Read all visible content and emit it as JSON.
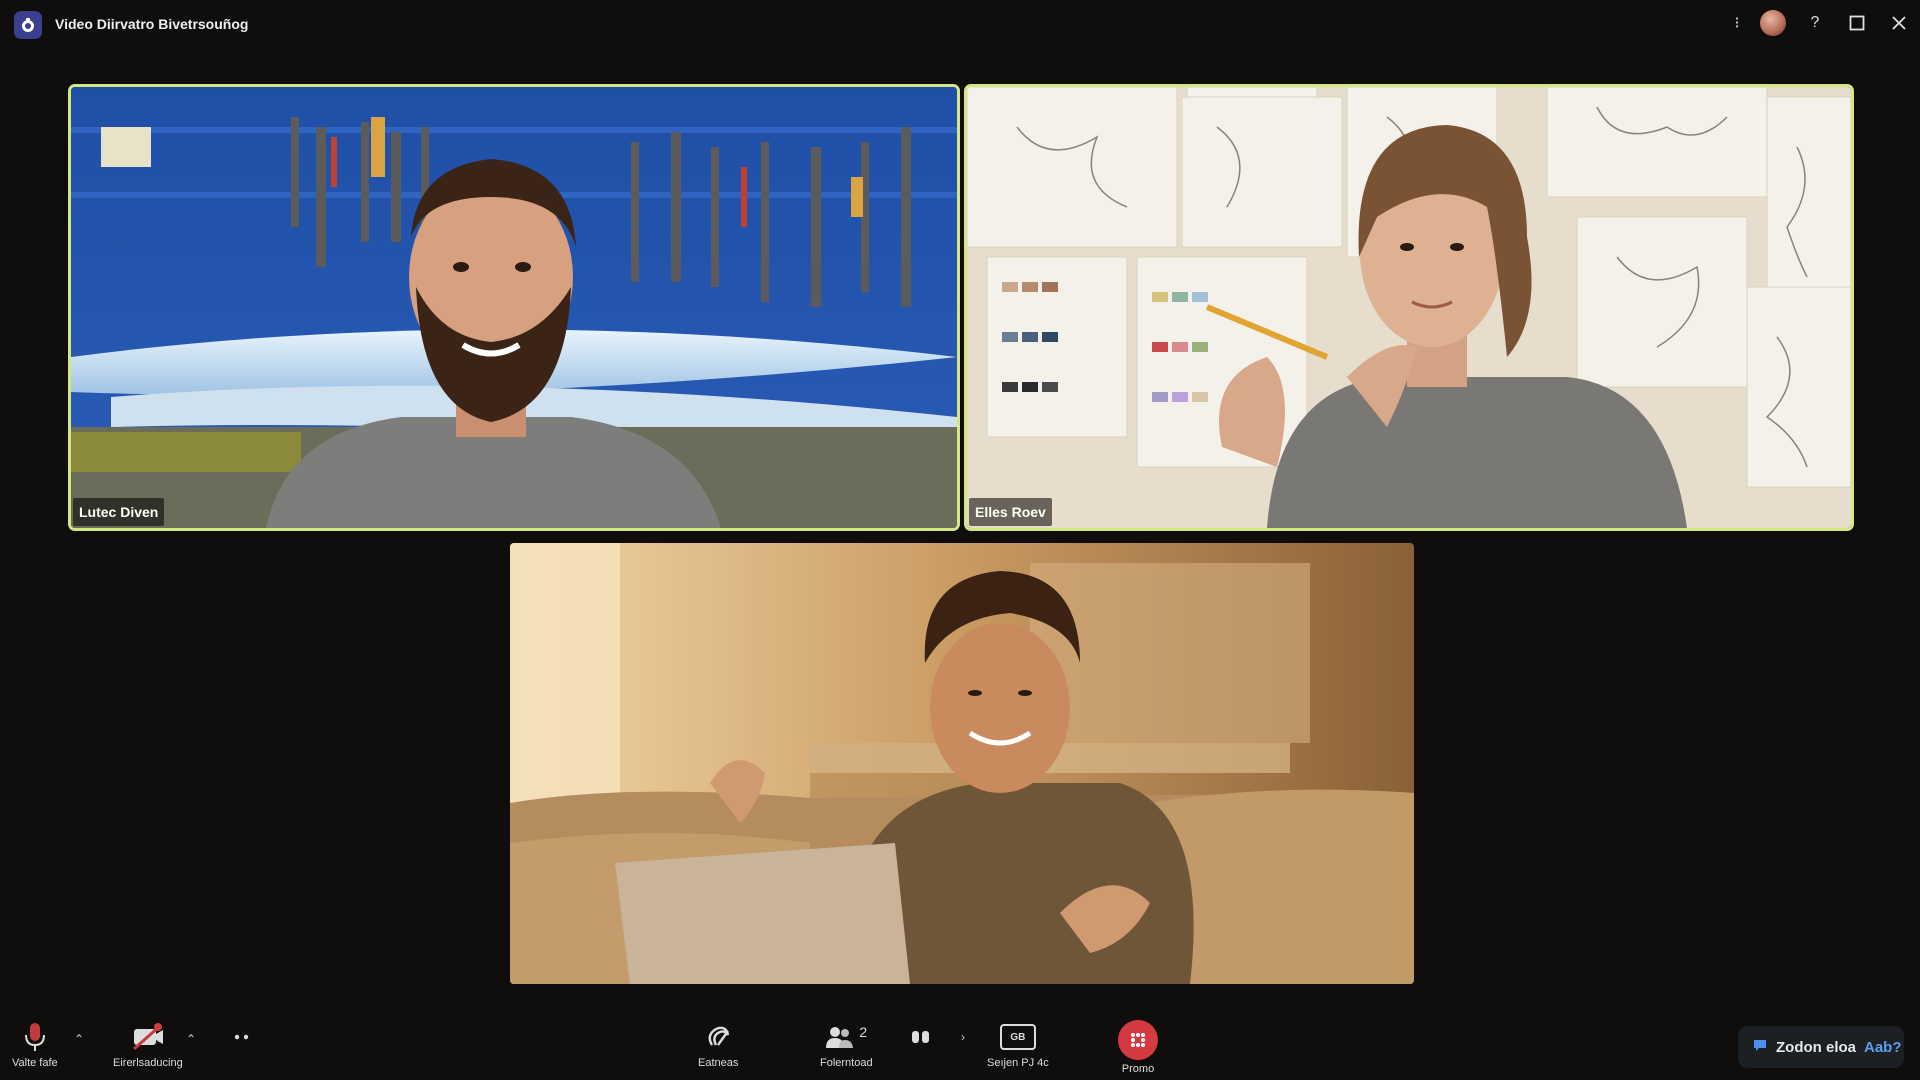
{
  "window": {
    "title": "Video Diirvatro Bivetrsouñog",
    "icon": "app-icon",
    "controls": [
      "info-icon",
      "avatar",
      "help-icon",
      "maximize-icon",
      "close-icon"
    ]
  },
  "participants": [
    {
      "name": "Lutec Diven",
      "active": true,
      "scene": "workshop"
    },
    {
      "name": "Elles Roev",
      "active": true,
      "scene": "art-studio"
    },
    {
      "name": "",
      "active": false,
      "scene": "living-room"
    }
  ],
  "toolbar": {
    "mute_label": "Valte fafe",
    "video_label": "Eirerlsaducing",
    "effects_label": "Eatneas",
    "participants_label": "Folerntoad",
    "participants_count": "2",
    "share_label": "Seıjen PJ 4c",
    "share_icon_text": "GB",
    "promo_label": "Promo",
    "help_text": "Zodon eloa",
    "help_link": "Aab?"
  },
  "colors": {
    "accent_border": "#d3e883",
    "promo": "#d43a3f",
    "help_link": "#5aa0f2"
  }
}
